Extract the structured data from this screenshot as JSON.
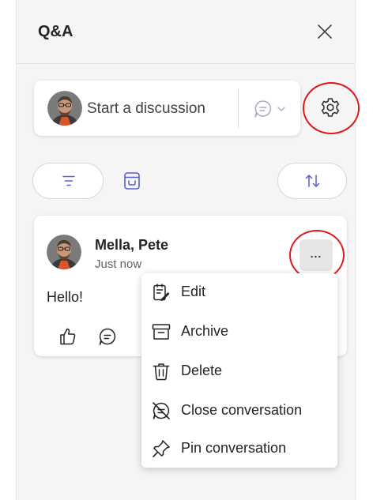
{
  "panel": {
    "title": "Q&A"
  },
  "compose": {
    "placeholder": "Start a discussion"
  },
  "post": {
    "author": "Mella, Pete",
    "timestamp": "Just now",
    "message": "Hello!",
    "more_label": "..."
  },
  "menu": {
    "items": [
      {
        "label": "Edit",
        "icon": "edit-icon"
      },
      {
        "label": "Archive",
        "icon": "archive-icon"
      },
      {
        "label": "Delete",
        "icon": "delete-icon"
      },
      {
        "label": "Close conversation",
        "icon": "close-conversation-icon"
      },
      {
        "label": "Pin conversation",
        "icon": "pin-icon"
      }
    ]
  },
  "colors": {
    "accent": "#5b5fc7",
    "highlight_circle": "#e01818",
    "panel_bg": "#f5f5f5",
    "card_bg": "#ffffff"
  }
}
